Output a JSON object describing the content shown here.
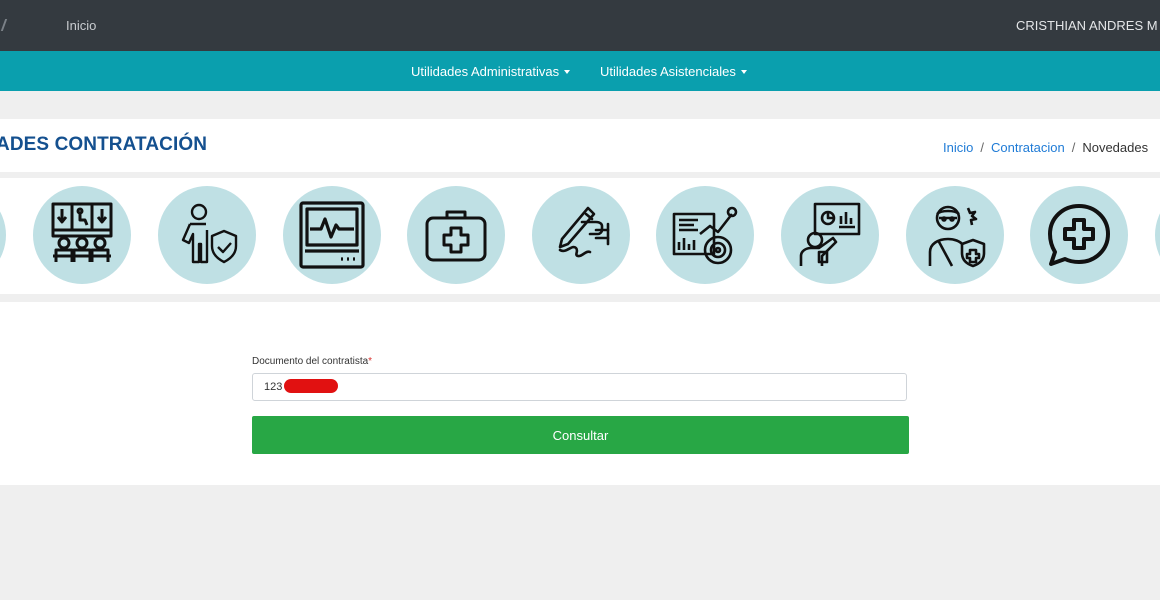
{
  "topbar": {
    "home_label": "Inicio",
    "user_name": "CRISTHIAN ANDRES M"
  },
  "menu": {
    "items": [
      {
        "label": "Utilidades Administrativas"
      },
      {
        "label": "Utilidades Asistenciales"
      }
    ]
  },
  "page": {
    "title": "ADES CONTRATACIÓN",
    "breadcrumb": {
      "home": "Inicio",
      "section": "Contratacion",
      "current": "Novedades"
    }
  },
  "icons": [
    "waiting-room-icon",
    "security-guard-icon",
    "heart-monitor-icon",
    "first-aid-kit-icon",
    "signature-icon",
    "analytics-dashboard-icon",
    "presentation-icon",
    "injured-patient-icon",
    "medical-chat-icon"
  ],
  "form": {
    "label": "Documento del contratista",
    "required_mark": "*",
    "value": "123",
    "submit_label": "Consultar"
  },
  "colors": {
    "topbar": "#343a40",
    "menubar": "#0a9fae",
    "title": "#14508f",
    "link": "#1f7bd6",
    "icon_circle": "#bfe0e4",
    "button": "#28a745",
    "redaction": "#e11111"
  }
}
